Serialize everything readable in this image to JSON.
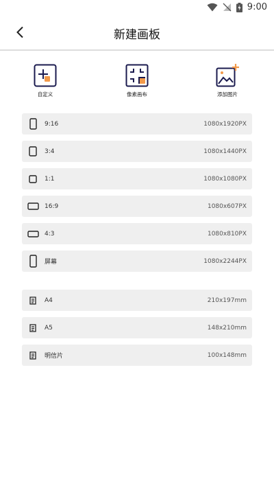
{
  "status": {
    "time": "9:00"
  },
  "header": {
    "title": "新建画板"
  },
  "tools": [
    {
      "label": "自定义"
    },
    {
      "label": "像素画布"
    },
    {
      "label": "添加图片"
    }
  ],
  "ratios": [
    {
      "name": "9:16",
      "size": "1080x1920PX"
    },
    {
      "name": "3:4",
      "size": "1080x1440PX"
    },
    {
      "name": "1:1",
      "size": "1080x1080PX"
    },
    {
      "name": "16:9",
      "size": "1080x607PX"
    },
    {
      "name": "4:3",
      "size": "1080x810PX"
    },
    {
      "name": "屏幕",
      "size": "1080x2244PX"
    }
  ],
  "papers": [
    {
      "name": "A4",
      "size": "210x197mm"
    },
    {
      "name": "A5",
      "size": "148x210mm"
    },
    {
      "name": "明信片",
      "size": "100x148mm"
    }
  ],
  "colors": {
    "icon_navy": "#1a1a4e",
    "accent_orange": "#f39a4a",
    "row_bg": "#efefef"
  }
}
